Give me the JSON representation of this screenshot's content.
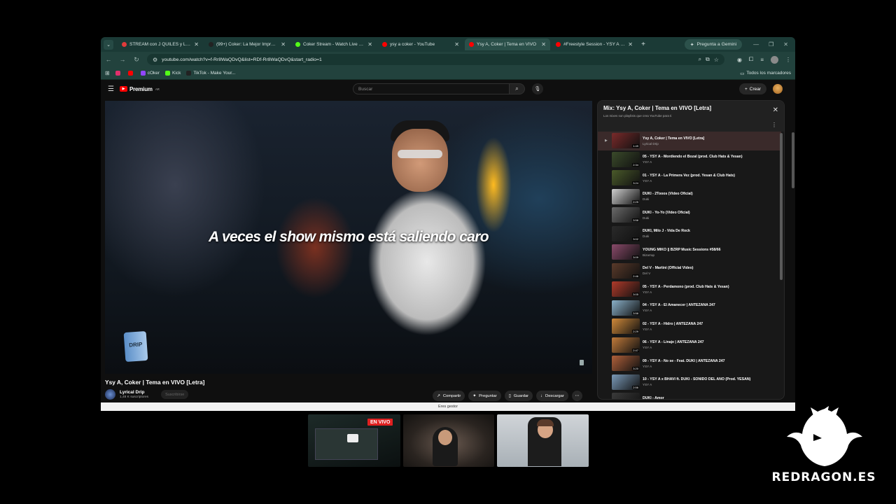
{
  "browser": {
    "tabs": [
      {
        "title": "STREAM con J QUILES y LENN...",
        "color": "#e03b3b",
        "active": false
      },
      {
        "title": "(99+) Coker: La Mejor Improvisa...",
        "color": "#222222",
        "active": false
      },
      {
        "title": "Coker Stream - Watch Live on K...",
        "color": "#53fc18",
        "active": false
      },
      {
        "title": "ysy a coker - YouTube",
        "color": "#ff0000",
        "active": false
      },
      {
        "title": "Ysy A, Coker | Tema en VIVO",
        "color": "#ff0000",
        "active": true
      },
      {
        "title": "#Freestyle Session - YSY A ft. C...",
        "color": "#ff0000",
        "active": false
      }
    ],
    "gemini_label": "Pregunta a Gemini",
    "url": "youtube.com/watch?v=f-Rr8WaQDvQ&list=RDf-Rr8WaQDvQ&start_radio=1",
    "bookmarks": [
      {
        "label": "",
        "color": "#e1306c"
      },
      {
        "label": "",
        "color": "#ff0000"
      },
      {
        "label": "cOker",
        "color": "#9146ff"
      },
      {
        "label": "Kick",
        "color": "#53fc18"
      },
      {
        "label": "TikTok - Make Your...",
        "color": "#222222"
      }
    ],
    "bookmarks_all": "Todos los marcadores",
    "status_text": "Eres gestor"
  },
  "youtube": {
    "logo_text": "Premium",
    "logo_region": "AR",
    "search_placeholder": "Buscar",
    "create_label": "Crear",
    "subtitle": "A veces el show mismo está saliendo caro",
    "cup_text": "DRIP",
    "video_title": "Ysy A, Coker | Tema en VIVO [Letra]",
    "channel_name": "Lyrical Drip",
    "channel_subs": "1,48 K suscriptores",
    "subscribe_label": "Suscribirse",
    "actions": [
      "Compartir",
      "Preguntar",
      "Guardar",
      "Descargar"
    ]
  },
  "playlist": {
    "title": "Mix: Ysy A, Coker | Tema en VIVO [Letra]",
    "subtitle": "Los mixes son playlists que crea YouTube para ti",
    "items": [
      {
        "title": "Ysy A, Coker | Tema en VIVO [Letra]",
        "artist": "Lyrical Drip",
        "duration": "1:49",
        "current": true,
        "color": "#7a2a2a"
      },
      {
        "title": "05 - YSY A - Mordiendo el Bozal (prod. Club Hats & Yesan)",
        "artist": "YSY A",
        "duration": "2:34",
        "current": false,
        "color": "#3a4a2a"
      },
      {
        "title": "01 - YSY A - La Primera Vez (prod. Yesan & Club Hats)",
        "artist": "YSY A",
        "duration": "3:24",
        "current": false,
        "color": "#4a5a2a"
      },
      {
        "title": "DUKI - 2Tooos (Video Oficial)",
        "artist": "Duki",
        "duration": "2:25",
        "current": false,
        "color": "#cfcfcf"
      },
      {
        "title": "DUKI - Yo-Yo (Video Oficial)",
        "artist": "Duki",
        "duration": "3:58",
        "current": false,
        "color": "#6a6a6a"
      },
      {
        "title": "DUKI, Milo J - Vida De Rock",
        "artist": "Duki",
        "duration": "3:02",
        "current": false,
        "color": "#2a2a2a"
      },
      {
        "title": "YOUNG MIKO || BZRP Music Sessions #58/66",
        "artist": "Bizarrap",
        "duration": "3:09",
        "current": false,
        "color": "#8a4a6a"
      },
      {
        "title": "Del V - Martini (Official Video)",
        "artist": "Del V",
        "duration": "2:46",
        "current": false,
        "color": "#5a3a2a"
      },
      {
        "title": "05 - YSY A - Perdamono (prod. Club Hats & Yesan)",
        "artist": "YSY A",
        "duration": "3:05",
        "current": false,
        "color": "#b03a2a"
      },
      {
        "title": "04 - YSY A - El Amanecer | ANTEZANA 247",
        "artist": "YSY A",
        "duration": "3:58",
        "current": false,
        "color": "#8ab0c8"
      },
      {
        "title": "02 - YSY A - Hidro | ANTEZANA 247",
        "artist": "YSY A",
        "duration": "2:29",
        "current": false,
        "color": "#d08a3a"
      },
      {
        "title": "06 - YSY A - Linaje | ANTEZANA 247",
        "artist": "YSY A",
        "duration": "2:47",
        "current": false,
        "color": "#c07a3a"
      },
      {
        "title": "09 - YSY A - No se - Feat. DUKI | ANTEZANA 247",
        "artist": "YSY A",
        "duration": "3:20",
        "current": false,
        "color": "#b0603a"
      },
      {
        "title": "10 - YSY A x BHAVI ft. DUKI - SONIDO DEL AÑO (Prod. YESAN)",
        "artist": "YSY A",
        "duration": "2:56",
        "current": false,
        "color": "#7a9ab8"
      },
      {
        "title": "DUKI - Amor",
        "artist": "Duki",
        "duration": "",
        "current": false,
        "color": "#3a3a3a"
      }
    ]
  },
  "overlay": {
    "live_badge": "EN VIVO",
    "brand": "REDRAGON.ES"
  }
}
